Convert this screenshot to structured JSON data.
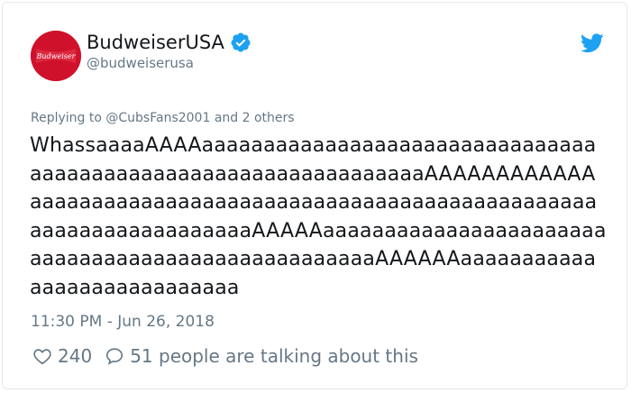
{
  "account": {
    "display_name": "BudweiserUSA",
    "handle": "@budweiserusa",
    "verified_icon": "verified-badge-icon",
    "avatar_logo_text": "Budweiser",
    "colors": {
      "avatar_bg": "#d0112b",
      "verified": "#1da1f2",
      "bird": "#1da1f2"
    }
  },
  "reply": {
    "prefix": "Replying to",
    "user": "@CubsFans2001",
    "suffix": "and 2 others"
  },
  "tweet": {
    "text": "WhassaaaaAAAAaaaaaaaaaaaaaaaaaaaaaaaaaaaaaaaaaaaaaaaaaaaaaaaaaaaaaaaaaaaaaaaaAAAAAAAAAAAAaaaaaaaaaaaaaaaaaaaaaaaaaaaaaaaaaaaaaaaaaaaaaaaaaaaaaaaaaaaaaaaaAAAAAaaaaaaaaaaaaaaaaaaaaaaaaaaaaaaaaaaaaaaaaaaaaaaaaaaaAAAAAAaaaaaaaaaaaaaaaaaaaaaaaaaaaa"
  },
  "meta": {
    "timestamp": "11:30 PM - Jun 26, 2018",
    "likes": "240",
    "talking": "51 people are talking about this"
  }
}
